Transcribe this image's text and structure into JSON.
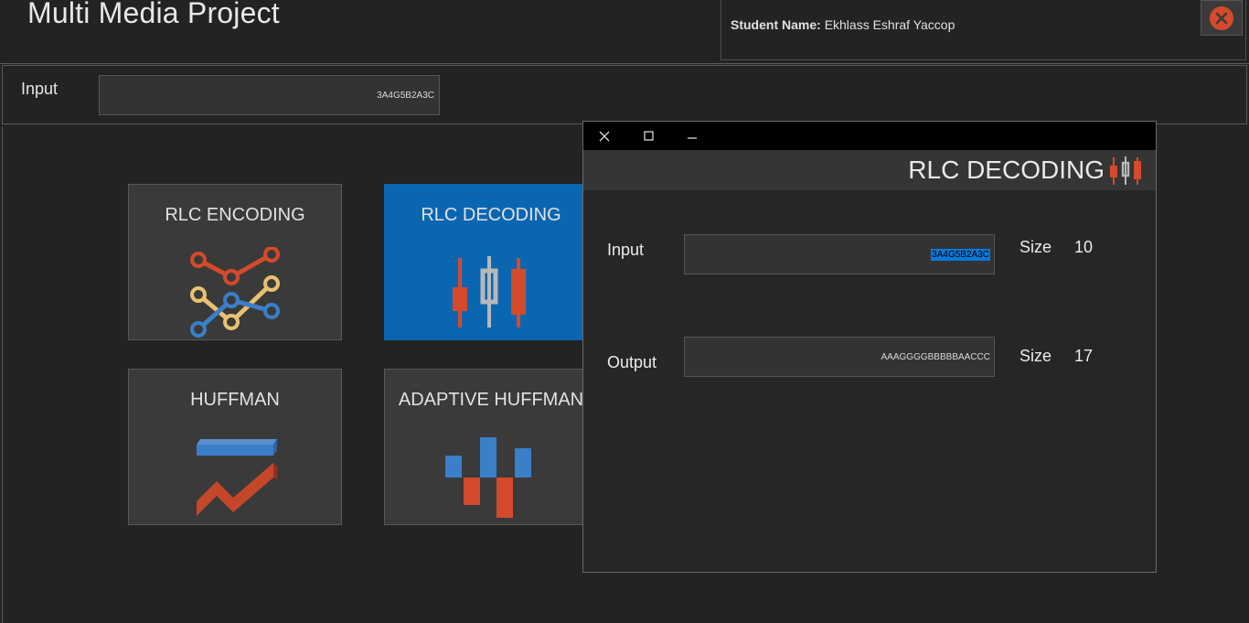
{
  "app": {
    "title": "Multi Media Project",
    "student_label": "Student Name:",
    "student_name": "Ekhlass Eshraf Yaccop",
    "close_icon": "close-icon"
  },
  "input_bar": {
    "label": "Input",
    "value": "3A4G5B2A3C"
  },
  "tiles": [
    {
      "label": "RLC ENCODING",
      "icon": "network-chart-icon"
    },
    {
      "label": "RLC DECODING",
      "icon": "candlestick-icon",
      "active": true
    },
    {
      "label": "HUFFMAN",
      "icon": "trend-bars-icon"
    },
    {
      "label": "ADAPTIVE HUFFMAN",
      "icon": "waterfall-chart-icon"
    }
  ],
  "dialog": {
    "title": "RLC DECODING",
    "titlebar_icons": [
      "close-icon",
      "maximize-icon",
      "minimize-icon"
    ],
    "input_label": "Input",
    "input_value": "3A4G5B2A3C",
    "input_size_label": "Size",
    "input_size": "10",
    "output_label": "Output",
    "output_value": "AAAGGGGBBBBBAACCC",
    "output_size_label": "Size",
    "output_size": "17"
  },
  "colors": {
    "accent_blue": "#0b66b2",
    "icon_red": "#d44a2b",
    "icon_yellow": "#e8c170",
    "icon_blue": "#3a7fc8",
    "icon_grey": "#b8b8b8"
  }
}
